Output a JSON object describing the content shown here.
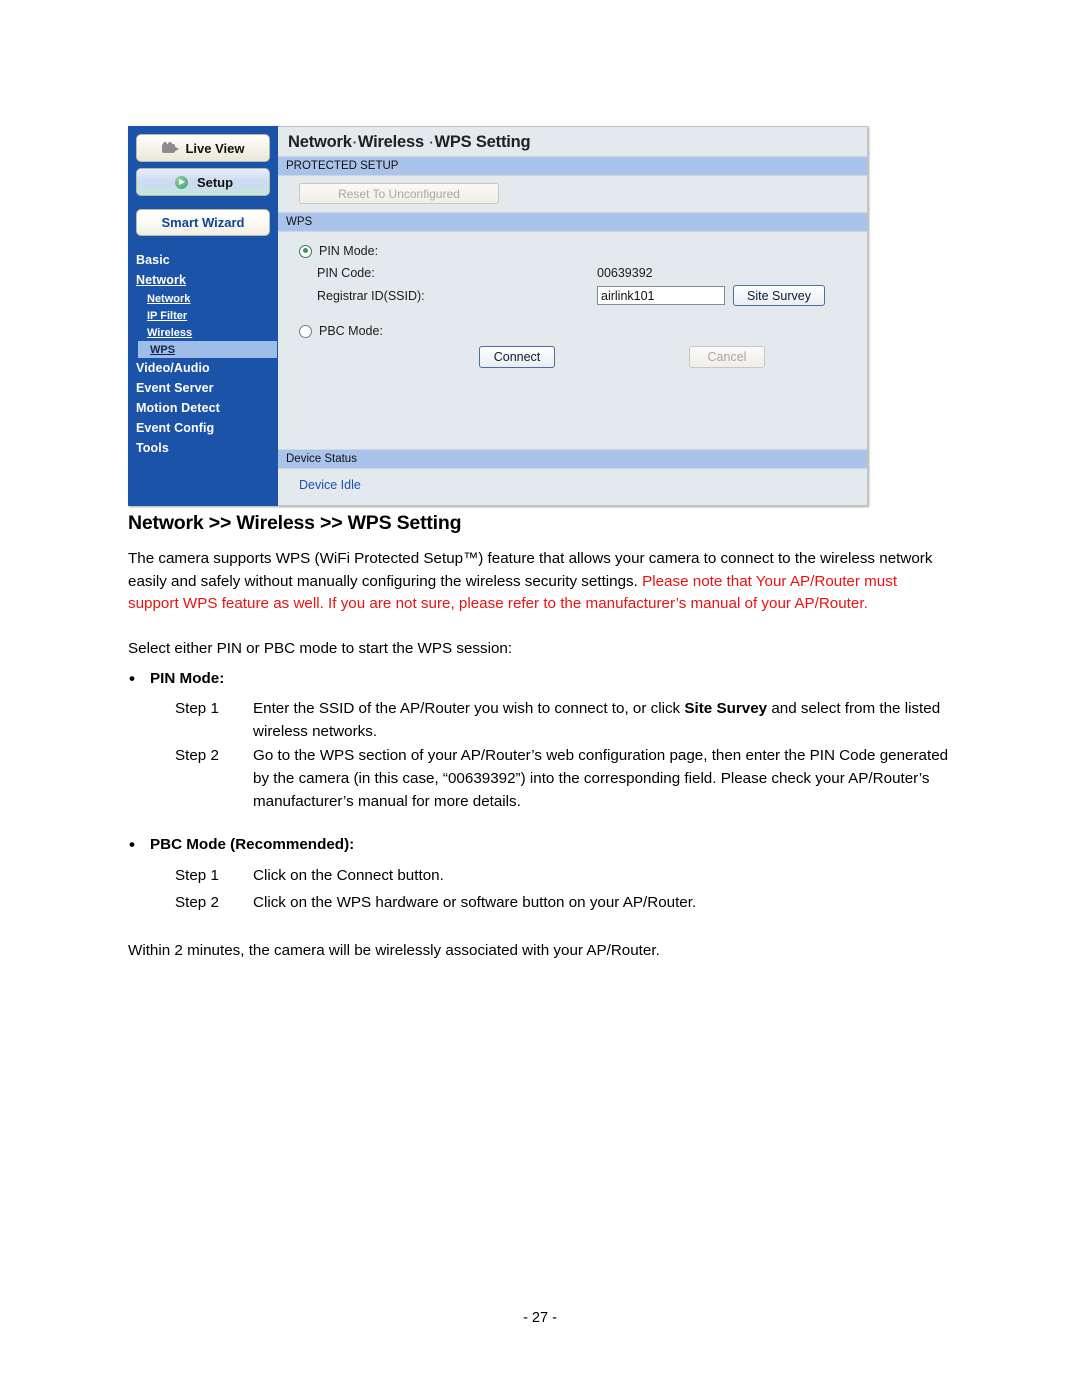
{
  "screenshot": {
    "sidebar": {
      "buttons": [
        {
          "label": "Live View",
          "icon": "camcorder-icon"
        },
        {
          "label": "Setup",
          "icon": "setup-play-icon"
        },
        {
          "label": "Smart Wizard",
          "icon": null
        }
      ],
      "nav": [
        {
          "label": "Basic",
          "type": "top",
          "active": false
        },
        {
          "label": "Network",
          "type": "top-link",
          "active": false
        },
        {
          "label": "Network",
          "type": "sub",
          "active": false
        },
        {
          "label": "IP Filter",
          "type": "sub",
          "active": false
        },
        {
          "label": "Wireless",
          "type": "sub",
          "active": false
        },
        {
          "label": "WPS",
          "type": "sub",
          "active": true
        },
        {
          "label": "Video/Audio",
          "type": "top",
          "active": false
        },
        {
          "label": "Event Server",
          "type": "top",
          "active": false
        },
        {
          "label": "Motion Detect",
          "type": "top",
          "active": false
        },
        {
          "label": "Event Config",
          "type": "top",
          "active": false
        },
        {
          "label": "Tools",
          "type": "top",
          "active": false
        }
      ]
    },
    "panel": {
      "title_part1": "Network",
      "title_sep": "·",
      "title_part2": "Wireless",
      "title_part3": "WPS Setting",
      "section_protected": "PROTECTED SETUP",
      "reset_button": "Reset To Unconfigured",
      "section_wps": "WPS",
      "pin_mode_label": "PIN Mode:",
      "pin_code_label": "PIN Code:",
      "pin_code_value": "00639392",
      "registrar_label": "Registrar ID(SSID):",
      "registrar_value": "airlink101",
      "site_survey_button": "Site Survey",
      "pbc_mode_label": "PBC Mode:",
      "connect_button": "Connect",
      "cancel_button": "Cancel",
      "section_device_status": "Device Status",
      "device_status_value": "Device Idle"
    }
  },
  "document": {
    "heading": "Network >> Wireless >> WPS Setting",
    "intro_black": "The camera supports WPS (WiFi Protected Setup™) feature that allows your camera to connect to the wireless network easily and safely without manually configuring the wireless security settings. ",
    "intro_red": "Please note that Your AP/Router must support WPS feature as well. If you are not sure, please refer to the manufacturer’s manual of your AP/Router.",
    "select_line": "Select either PIN or PBC mode to start the WPS session:",
    "pin_bullet": "PIN Mode:",
    "pin_step1_label": "Step 1",
    "pin_step1_a": "Enter the SSID of the AP/Router you wish to connect to, or click ",
    "pin_step1_bold": "Site Survey",
    "pin_step1_b": " and select from the listed wireless networks.",
    "pin_step2_label": "Step 2",
    "pin_step2_text": "Go to the WPS section of your AP/Router’s web configuration page, then enter the PIN Code generated by the camera (in this case, “00639392”) into the corresponding field. Please check your AP/Router’s manufacturer’s manual for more details.",
    "pbc_bullet": "PBC Mode (Recommended):",
    "pbc_step1_label": "Step 1",
    "pbc_step1_text": "Click on the Connect button.",
    "pbc_step2_label": "Step 2",
    "pbc_step2_text": "Click on the WPS hardware or software button on your AP/Router.",
    "closing": "Within 2 minutes, the camera will be wirelessly associated with your AP/Router."
  },
  "footer": {
    "page_number": "- 27 -"
  },
  "colors": {
    "sidebar_blue": "#1a53a8",
    "section_bar_blue": "#aac3ea",
    "panel_bg": "#e4e9ee",
    "status_link_blue": "#1d4fbf",
    "warning_red": "#ee1111"
  }
}
